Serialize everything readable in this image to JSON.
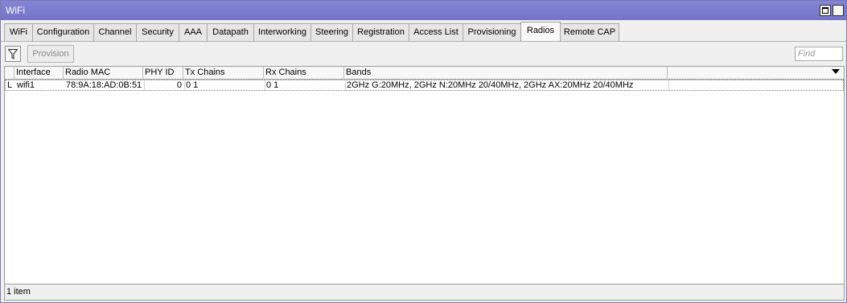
{
  "window": {
    "title": "WiFi"
  },
  "tabs": [
    {
      "label": "WiFi"
    },
    {
      "label": "Configuration"
    },
    {
      "label": "Channel"
    },
    {
      "label": "Security"
    },
    {
      "label": "AAA"
    },
    {
      "label": "Datapath"
    },
    {
      "label": "Interworking"
    },
    {
      "label": "Steering"
    },
    {
      "label": "Registration"
    },
    {
      "label": "Access List"
    },
    {
      "label": "Provisioning"
    },
    {
      "label": "Radios"
    },
    {
      "label": "Remote CAP"
    }
  ],
  "active_tab": "Radios",
  "toolbar": {
    "filter_icon": "filter-icon",
    "provision_label": "Provision",
    "find_placeholder": "Find",
    "find_value": ""
  },
  "table": {
    "columns": [
      "Interface",
      "Radio MAC",
      "PHY ID",
      "Tx Chains",
      "Rx Chains",
      "Bands"
    ],
    "rows": [
      {
        "flag": "L",
        "interface": "wifi1",
        "radio_mac": "78:9A:18:AD:0B:51",
        "phy_id": "0",
        "tx_chains": "0 1",
        "rx_chains": "0 1",
        "bands": "2GHz G:20MHz, 2GHz N:20MHz 20/40MHz, 2GHz AX:20MHz 20/40MHz"
      }
    ]
  },
  "status": {
    "text": "1 item"
  }
}
